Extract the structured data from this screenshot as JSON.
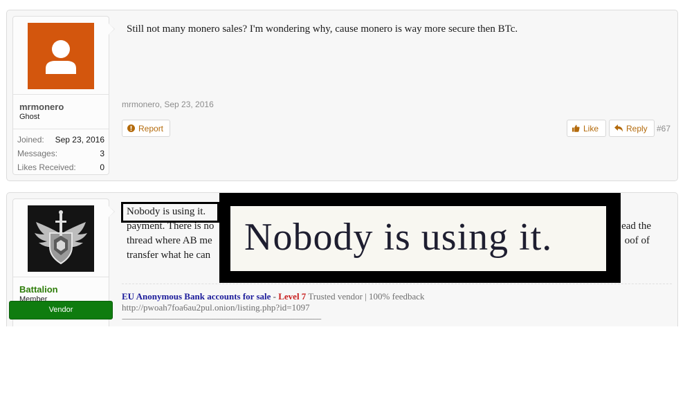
{
  "post1": {
    "username": "mrmonero",
    "user_title": "Ghost",
    "avatar_icon": "default-user-icon",
    "stats": [
      {
        "label": "Joined:",
        "value": "Sep 23, 2016"
      },
      {
        "label": "Messages:",
        "value": "3"
      },
      {
        "label": "Likes Received:",
        "value": "0"
      }
    ],
    "message": "Still not many monero sales? I'm wondering why, cause monero is way more secure then BTc.",
    "meta": "mrmonero, Sep 23, 2016",
    "report_label": "Report",
    "like_label": "Like",
    "reply_label": "Reply",
    "post_number": "#67"
  },
  "post2": {
    "username": "Battalion",
    "user_title": "Member",
    "badge": "Vendor",
    "avatar_icon": "winged-shield-icon",
    "message_line1": "Nobody is using it. ",
    "message_line2_start": "payment. There is no",
    "message_line2_end": "ead the",
    "message_line3_start": "thread where AB me",
    "message_line3_end": "oof of",
    "message_line4_start": "transfer what he can",
    "signature": {
      "title": "EU Anonymous Bank accounts for sale",
      "dash": " - ",
      "level": "Level 7",
      "rest": " Trusted vendor | 100% feedback",
      "url": "http://pwoah7foa6au2pul.onion/listing.php?id=1097",
      "line": "------------------------------------------------------------------------------------------------------------"
    }
  },
  "zoom": {
    "text": "Nobody is using it."
  },
  "colors": {
    "accent": "#b36a0b",
    "vendor_green": "#0f7c0f",
    "avatar_orange": "#d3560d"
  }
}
